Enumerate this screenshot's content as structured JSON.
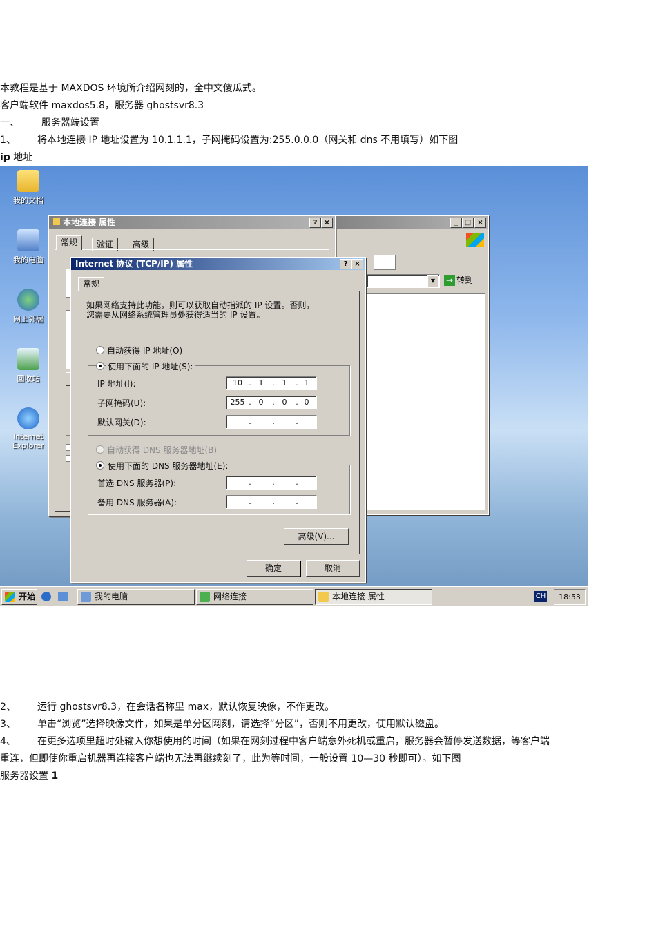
{
  "doc": {
    "line1": "本教程是基于 MAXDOS 环境所介绍网刻的，全中文傻瓜式。",
    "line2": "客户端软件 maxdos5.8，服务器 ghostsvr8.3",
    "section1_num": "一、",
    "section1_text": "服务器端设置",
    "step1_num": "1、",
    "step1_text": "将本地连接 IP 地址设置为 10.1.1.1，子网掩码设置为:255.0.0.0（网关和 dns 不用填写）如下图",
    "caption1_bold": "ip",
    "caption1_rest": " 地址",
    "step2_num": "2、",
    "step2_text": "运行 ghostsvr8.3，在会话名称里 max，默认恢复映像，不作更改。",
    "step3_num": "3、",
    "step3_text": "单击“浏览”选择映像文件，如果是单分区网刻，请选择“分区”，否则不用更改，使用默认磁盘。",
    "step4_num": "4、",
    "step4_text": "在更多选项里超时处输入你想使用的时间（如果在网刻过程中客户端意外死机或重启，服务器会暂停发送数据，等客户端",
    "step4_cont": "重连，但即使你重启机器再连接客户端也无法再继续刻了，此为等时间，一般设置 10—30 秒即可）。如下图",
    "caption2_rest": "服务器设置 ",
    "caption2_bold": "1"
  },
  "desktop": {
    "icons": [
      "我的文档",
      "我的电脑",
      "网上邻居",
      "回收站",
      "Internet Explorer"
    ]
  },
  "explorer": {
    "go_label": "转到",
    "menu_icon": "view-menu-icon"
  },
  "local_conn": {
    "title": "本地连接 属性",
    "tabs": [
      "常规",
      "验证",
      "高级"
    ],
    "help": "?",
    "close": "×"
  },
  "tcpip": {
    "title": "Internet 协议 (TCP/IP) 属性",
    "tab": "常规",
    "help": "?",
    "close": "×",
    "desc1": "如果网络支持此功能，则可以获取自动指派的 IP 设置。否则，",
    "desc2": "您需要从网络系统管理员处获得适当的 IP 设置。",
    "radio_auto_ip": "自动获得 IP 地址(O)",
    "radio_manual_ip": "使用下面的 IP 地址(S):",
    "ip_label": "IP 地址(I):",
    "ip": [
      "10",
      "1",
      "1",
      "1"
    ],
    "mask_label": "子网掩码(U):",
    "mask": [
      "255",
      "0",
      "0",
      "0"
    ],
    "gw_label": "默认网关(D):",
    "radio_auto_dns": "自动获得 DNS 服务器地址(B)",
    "radio_manual_dns": "使用下面的 DNS 服务器地址(E):",
    "dns1_label": "首选 DNS 服务器(P):",
    "dns2_label": "备用 DNS 服务器(A):",
    "advanced": "高级(V)...",
    "ok": "确定",
    "cancel": "取消",
    "dot": "."
  },
  "taskbar": {
    "start": "开始",
    "tasks": [
      "我的电脑",
      "网络连接",
      "本地连接 属性"
    ],
    "lang": "CH",
    "time": "18:53"
  },
  "colors": {
    "title_active": "#0a246a",
    "desktop": "#5a8fd8"
  }
}
